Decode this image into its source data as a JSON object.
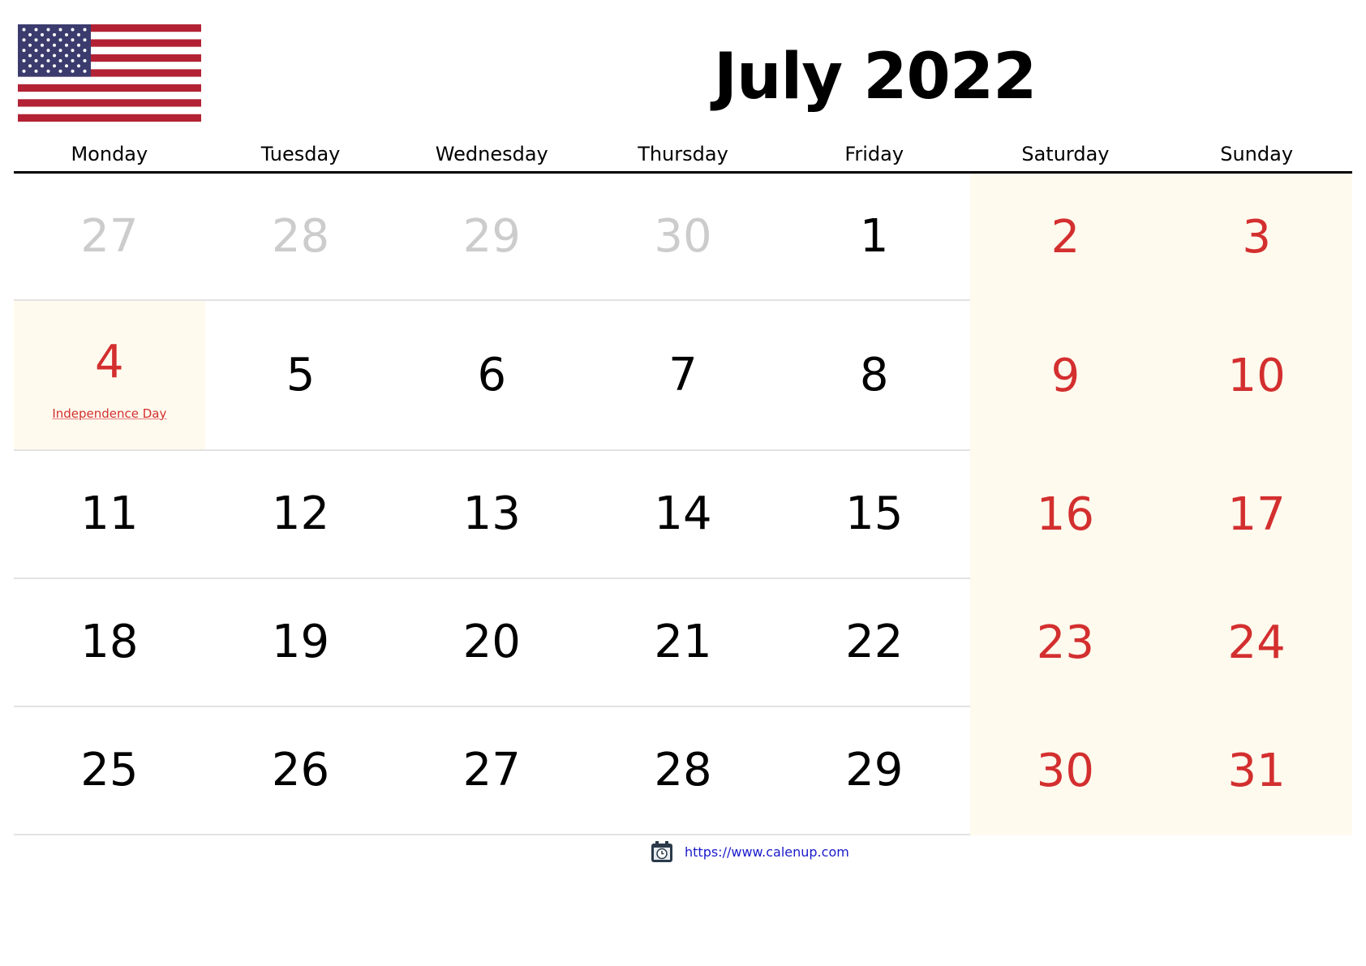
{
  "title": "July 2022",
  "flag": {
    "icon": "us-flag-icon",
    "colors": {
      "red": "#b22234",
      "blue": "#3c3b6e",
      "white": "#ffffff"
    }
  },
  "weekdays": [
    "Monday",
    "Tuesday",
    "Wednesday",
    "Thursday",
    "Friday",
    "Saturday",
    "Sunday"
  ],
  "colors": {
    "weekend_text": "#d32f2f",
    "weekend_bg": "#fffaee",
    "other_month_text": "#cccccc",
    "link": "#1a1acc"
  },
  "weeks": [
    [
      {
        "day": "27",
        "type": "other"
      },
      {
        "day": "28",
        "type": "other"
      },
      {
        "day": "29",
        "type": "other"
      },
      {
        "day": "30",
        "type": "other"
      },
      {
        "day": "1",
        "type": "normal"
      },
      {
        "day": "2",
        "type": "weekend"
      },
      {
        "day": "3",
        "type": "weekend"
      }
    ],
    [
      {
        "day": "4",
        "type": "holiday",
        "holiday": "Independence Day"
      },
      {
        "day": "5",
        "type": "normal"
      },
      {
        "day": "6",
        "type": "normal"
      },
      {
        "day": "7",
        "type": "normal"
      },
      {
        "day": "8",
        "type": "normal"
      },
      {
        "day": "9",
        "type": "weekend"
      },
      {
        "day": "10",
        "type": "weekend"
      }
    ],
    [
      {
        "day": "11",
        "type": "normal"
      },
      {
        "day": "12",
        "type": "normal"
      },
      {
        "day": "13",
        "type": "normal"
      },
      {
        "day": "14",
        "type": "normal"
      },
      {
        "day": "15",
        "type": "normal"
      },
      {
        "day": "16",
        "type": "weekend"
      },
      {
        "day": "17",
        "type": "weekend"
      }
    ],
    [
      {
        "day": "18",
        "type": "normal"
      },
      {
        "day": "19",
        "type": "normal"
      },
      {
        "day": "20",
        "type": "normal"
      },
      {
        "day": "21",
        "type": "normal"
      },
      {
        "day": "22",
        "type": "normal"
      },
      {
        "day": "23",
        "type": "weekend"
      },
      {
        "day": "24",
        "type": "weekend"
      }
    ],
    [
      {
        "day": "25",
        "type": "normal"
      },
      {
        "day": "26",
        "type": "normal"
      },
      {
        "day": "27",
        "type": "normal"
      },
      {
        "day": "28",
        "type": "normal"
      },
      {
        "day": "29",
        "type": "normal"
      },
      {
        "day": "30",
        "type": "weekend"
      },
      {
        "day": "31",
        "type": "weekend"
      }
    ]
  ],
  "footer": {
    "icon": "calendar-clock-icon",
    "link_text": "https://www.calenup.com"
  }
}
